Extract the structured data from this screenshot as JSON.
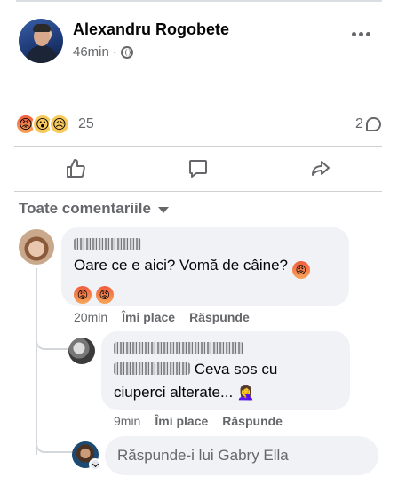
{
  "post": {
    "author": "Alexandru Rogobete",
    "time": "46min",
    "separator": "·",
    "privacy_icon": "globe-icon",
    "more_icon": "more-dots-icon"
  },
  "stats": {
    "reaction_icons": [
      "angry",
      "wow",
      "sad"
    ],
    "reactions_count": "25",
    "comments_count": "2"
  },
  "actions": {
    "like_icon": "thumb-up-icon",
    "comment_icon": "comment-icon",
    "share_icon": "share-icon"
  },
  "filter": {
    "label": "Toate comentariile"
  },
  "comments": [
    {
      "text": "Oare ce e aici? Vomă de câine?",
      "time": "20min",
      "like": "Îmi place",
      "reply": "Răspunde"
    },
    {
      "text": "Ceva sos cu",
      "text2": "ciuperci alterate...",
      "time": "9min",
      "like": "Îmi place",
      "reply": "Răspunde"
    }
  ],
  "reply_box": {
    "placeholder": "Răspunde-i lui Gabry Ella"
  },
  "colors": {
    "muted": "#65676b",
    "bubble": "#f0f2f5",
    "divider": "#ced0d4"
  }
}
